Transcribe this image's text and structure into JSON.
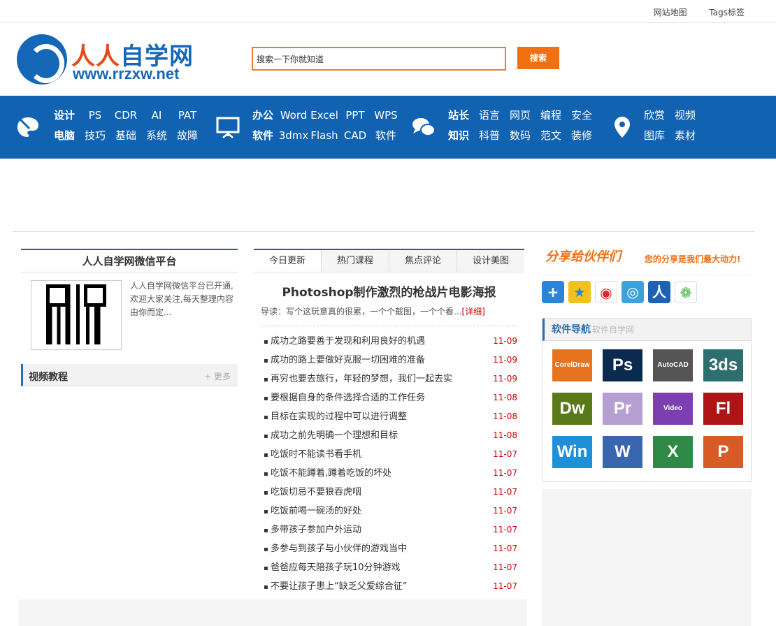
{
  "topbar": {
    "sitemap": "网站地图",
    "tags": "Tags标签"
  },
  "logo": {
    "name_blue": "自学网",
    "name_red": "人人",
    "url": "www.rrzxw.net"
  },
  "search": {
    "placeholder": "搜索一下你就知道",
    "button": "搜索"
  },
  "nav": {
    "groups": [
      {
        "icon": "palette-icon",
        "items": [
          "设计",
          "电脑",
          "PS",
          "技巧",
          "CDR",
          "基础",
          "AI",
          "系统",
          "PAT",
          "故障"
        ]
      },
      {
        "icon": "presentation-icon",
        "items": [
          "办公",
          "软件",
          "Word",
          "3dmx",
          "Excel",
          "Flash",
          "PPT",
          "CAD",
          "WPS",
          "软件"
        ]
      },
      {
        "icon": "chat-icon",
        "items": [
          "站长",
          "知识",
          "语言",
          "科普",
          "网页",
          "数码",
          "编程",
          "范文",
          "安全",
          "装修"
        ]
      },
      {
        "icon": "location-icon",
        "items": [
          "欣赏",
          "图库",
          "视频",
          "素材"
        ]
      }
    ]
  },
  "left": {
    "wechat_title": "人人自学网微信平台",
    "wechat_text": "人人自学网微信平台已开通,欢迎大家关注,每天整理内容由你而定...",
    "video_title": "视频教程",
    "more": "+ 更多"
  },
  "mid": {
    "tabs": [
      "今日更新",
      "热门课程",
      "焦点评论",
      "设计美图"
    ],
    "headline": "Photoshop制作激烈的枪战片电影海报",
    "intro": "导读：写个这玩意真的很累，一个个截图，一个个看...",
    "detail": "[详细]",
    "news": [
      {
        "title": "成功之路要善于发现和利用良好的机遇",
        "date": "11-09"
      },
      {
        "title": "成功的路上要做好克服一切困难的准备",
        "date": "11-09"
      },
      {
        "title": "再穷也要去旅行，年轻的梦想，我们一起去实",
        "date": "11-09"
      },
      {
        "title": "要根据自身的条件选择合适的工作任务",
        "date": "11-08"
      },
      {
        "title": "目标在实现的过程中可以进行调整",
        "date": "11-08"
      },
      {
        "title": "成功之前先明确一个理想和目标",
        "date": "11-08"
      },
      {
        "title": "吃饭时不能读书看手机",
        "date": "11-07"
      },
      {
        "title": "吃饭不能蹲着,蹲着吃饭的坏处",
        "date": "11-07"
      },
      {
        "title": "吃饭切忌不要狼吞虎咽",
        "date": "11-07"
      },
      {
        "title": "吃饭前喝一碗汤的好处",
        "date": "11-07"
      },
      {
        "title": "多带孩子参加户外运动",
        "date": "11-07"
      },
      {
        "title": "多参与到孩子与小伙伴的游戏当中",
        "date": "11-07"
      },
      {
        "title": "爸爸应每天陪孩子玩10分钟游戏",
        "date": "11-07"
      },
      {
        "title": "不要让孩子患上“缺乏父爱综合征”",
        "date": "11-07"
      }
    ]
  },
  "right": {
    "share_title": "分享给伙伴们",
    "share_sub": "您的分享是我们最大动力!",
    "share_icons": [
      "plus-icon",
      "qzone-icon",
      "weibo-icon",
      "tqq-icon",
      "renren-icon",
      "wechat-icon"
    ],
    "nav_title": "软件导航",
    "nav_sub": "软件自学网",
    "apps": [
      {
        "label": "CorelDraw",
        "color": "#e8731f"
      },
      {
        "label": "Ps",
        "color": "#0a2a4f"
      },
      {
        "label": "AutoCAD",
        "color": "#555555"
      },
      {
        "label": "3ds",
        "color": "#2d6e6e"
      },
      {
        "label": "Dw",
        "color": "#5a7a1a"
      },
      {
        "label": "Pr",
        "color": "#b59fd0"
      },
      {
        "label": "Video",
        "color": "#7b3fb2"
      },
      {
        "label": "Fl",
        "color": "#b01515"
      },
      {
        "label": "Win",
        "color": "#1e90d8"
      },
      {
        "label": "W",
        "color": "#3a66b0"
      },
      {
        "label": "X",
        "color": "#2f8a47"
      },
      {
        "label": "P",
        "color": "#d85b26"
      }
    ]
  }
}
